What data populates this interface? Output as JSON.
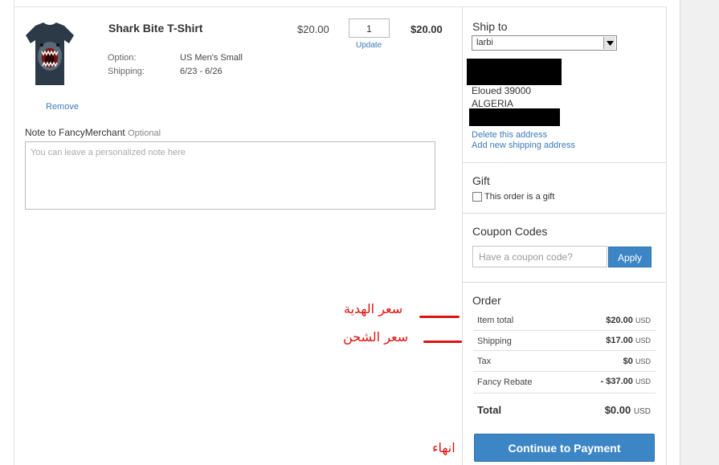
{
  "product": {
    "title": "Shark Bite T-Shirt",
    "option_label": "Option:",
    "option_value": "US Men's Small",
    "shipping_label": "Shipping:",
    "shipping_value": "6/23 - 6/26",
    "price": "$20.00",
    "quantity": "1",
    "update_label": "Update",
    "line_total": "$20.00",
    "remove_label": "Remove"
  },
  "note": {
    "label": "Note to FancyMerchant",
    "optional": "Optional",
    "placeholder": "You can leave a personalized note here"
  },
  "ship_to": {
    "title": "Ship to",
    "selected": "larbi",
    "address_line_city": "Eloued 39000",
    "address_line_country": "ALGERIA",
    "delete_link": "Delete this address",
    "add_link": "Add new shipping address"
  },
  "gift": {
    "title": "Gift",
    "checkbox_label": "This order is a gift",
    "checked": false
  },
  "coupon": {
    "title": "Coupon Codes",
    "placeholder": "Have a coupon code?",
    "apply_label": "Apply"
  },
  "order": {
    "title": "Order",
    "currency": "USD",
    "rows": [
      {
        "label": "Item total",
        "value": "$20.00"
      },
      {
        "label": "Shipping",
        "value": "$17.00"
      },
      {
        "label": "Tax",
        "value": "$0"
      },
      {
        "label": "Fancy Rebate",
        "value": "- $37.00"
      }
    ],
    "total_label": "Total",
    "total_value": "$0.00",
    "pay_button": "Continue to Payment"
  },
  "annotations": {
    "gift_price": "سعر الهدية",
    "shipping_price": "سعر الشحن",
    "finish": "انهاء",
    "color": "#dd1111"
  }
}
